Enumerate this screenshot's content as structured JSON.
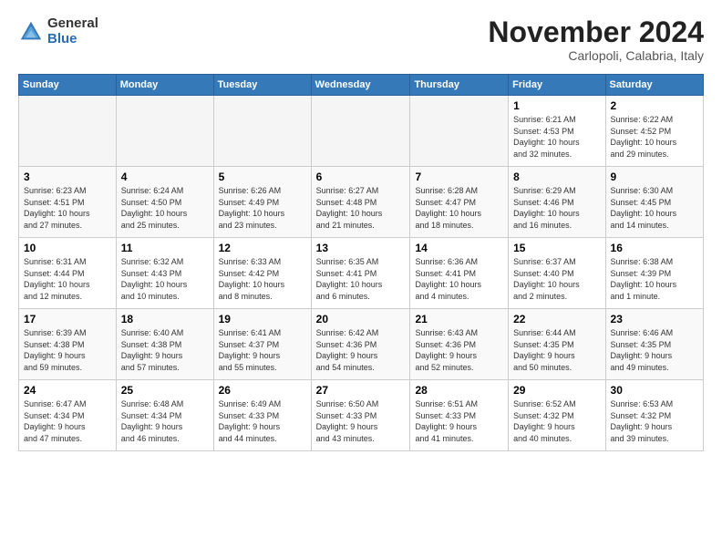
{
  "logo": {
    "general": "General",
    "blue": "Blue"
  },
  "header": {
    "month": "November 2024",
    "location": "Carlopoli, Calabria, Italy"
  },
  "weekdays": [
    "Sunday",
    "Monday",
    "Tuesday",
    "Wednesday",
    "Thursday",
    "Friday",
    "Saturday"
  ],
  "weeks": [
    [
      {
        "day": "",
        "info": ""
      },
      {
        "day": "",
        "info": ""
      },
      {
        "day": "",
        "info": ""
      },
      {
        "day": "",
        "info": ""
      },
      {
        "day": "",
        "info": ""
      },
      {
        "day": "1",
        "info": "Sunrise: 6:21 AM\nSunset: 4:53 PM\nDaylight: 10 hours\nand 32 minutes."
      },
      {
        "day": "2",
        "info": "Sunrise: 6:22 AM\nSunset: 4:52 PM\nDaylight: 10 hours\nand 29 minutes."
      }
    ],
    [
      {
        "day": "3",
        "info": "Sunrise: 6:23 AM\nSunset: 4:51 PM\nDaylight: 10 hours\nand 27 minutes."
      },
      {
        "day": "4",
        "info": "Sunrise: 6:24 AM\nSunset: 4:50 PM\nDaylight: 10 hours\nand 25 minutes."
      },
      {
        "day": "5",
        "info": "Sunrise: 6:26 AM\nSunset: 4:49 PM\nDaylight: 10 hours\nand 23 minutes."
      },
      {
        "day": "6",
        "info": "Sunrise: 6:27 AM\nSunset: 4:48 PM\nDaylight: 10 hours\nand 21 minutes."
      },
      {
        "day": "7",
        "info": "Sunrise: 6:28 AM\nSunset: 4:47 PM\nDaylight: 10 hours\nand 18 minutes."
      },
      {
        "day": "8",
        "info": "Sunrise: 6:29 AM\nSunset: 4:46 PM\nDaylight: 10 hours\nand 16 minutes."
      },
      {
        "day": "9",
        "info": "Sunrise: 6:30 AM\nSunset: 4:45 PM\nDaylight: 10 hours\nand 14 minutes."
      }
    ],
    [
      {
        "day": "10",
        "info": "Sunrise: 6:31 AM\nSunset: 4:44 PM\nDaylight: 10 hours\nand 12 minutes."
      },
      {
        "day": "11",
        "info": "Sunrise: 6:32 AM\nSunset: 4:43 PM\nDaylight: 10 hours\nand 10 minutes."
      },
      {
        "day": "12",
        "info": "Sunrise: 6:33 AM\nSunset: 4:42 PM\nDaylight: 10 hours\nand 8 minutes."
      },
      {
        "day": "13",
        "info": "Sunrise: 6:35 AM\nSunset: 4:41 PM\nDaylight: 10 hours\nand 6 minutes."
      },
      {
        "day": "14",
        "info": "Sunrise: 6:36 AM\nSunset: 4:41 PM\nDaylight: 10 hours\nand 4 minutes."
      },
      {
        "day": "15",
        "info": "Sunrise: 6:37 AM\nSunset: 4:40 PM\nDaylight: 10 hours\nand 2 minutes."
      },
      {
        "day": "16",
        "info": "Sunrise: 6:38 AM\nSunset: 4:39 PM\nDaylight: 10 hours\nand 1 minute."
      }
    ],
    [
      {
        "day": "17",
        "info": "Sunrise: 6:39 AM\nSunset: 4:38 PM\nDaylight: 9 hours\nand 59 minutes."
      },
      {
        "day": "18",
        "info": "Sunrise: 6:40 AM\nSunset: 4:38 PM\nDaylight: 9 hours\nand 57 minutes."
      },
      {
        "day": "19",
        "info": "Sunrise: 6:41 AM\nSunset: 4:37 PM\nDaylight: 9 hours\nand 55 minutes."
      },
      {
        "day": "20",
        "info": "Sunrise: 6:42 AM\nSunset: 4:36 PM\nDaylight: 9 hours\nand 54 minutes."
      },
      {
        "day": "21",
        "info": "Sunrise: 6:43 AM\nSunset: 4:36 PM\nDaylight: 9 hours\nand 52 minutes."
      },
      {
        "day": "22",
        "info": "Sunrise: 6:44 AM\nSunset: 4:35 PM\nDaylight: 9 hours\nand 50 minutes."
      },
      {
        "day": "23",
        "info": "Sunrise: 6:46 AM\nSunset: 4:35 PM\nDaylight: 9 hours\nand 49 minutes."
      }
    ],
    [
      {
        "day": "24",
        "info": "Sunrise: 6:47 AM\nSunset: 4:34 PM\nDaylight: 9 hours\nand 47 minutes."
      },
      {
        "day": "25",
        "info": "Sunrise: 6:48 AM\nSunset: 4:34 PM\nDaylight: 9 hours\nand 46 minutes."
      },
      {
        "day": "26",
        "info": "Sunrise: 6:49 AM\nSunset: 4:33 PM\nDaylight: 9 hours\nand 44 minutes."
      },
      {
        "day": "27",
        "info": "Sunrise: 6:50 AM\nSunset: 4:33 PM\nDaylight: 9 hours\nand 43 minutes."
      },
      {
        "day": "28",
        "info": "Sunrise: 6:51 AM\nSunset: 4:33 PM\nDaylight: 9 hours\nand 41 minutes."
      },
      {
        "day": "29",
        "info": "Sunrise: 6:52 AM\nSunset: 4:32 PM\nDaylight: 9 hours\nand 40 minutes."
      },
      {
        "day": "30",
        "info": "Sunrise: 6:53 AM\nSunset: 4:32 PM\nDaylight: 9 hours\nand 39 minutes."
      }
    ]
  ]
}
